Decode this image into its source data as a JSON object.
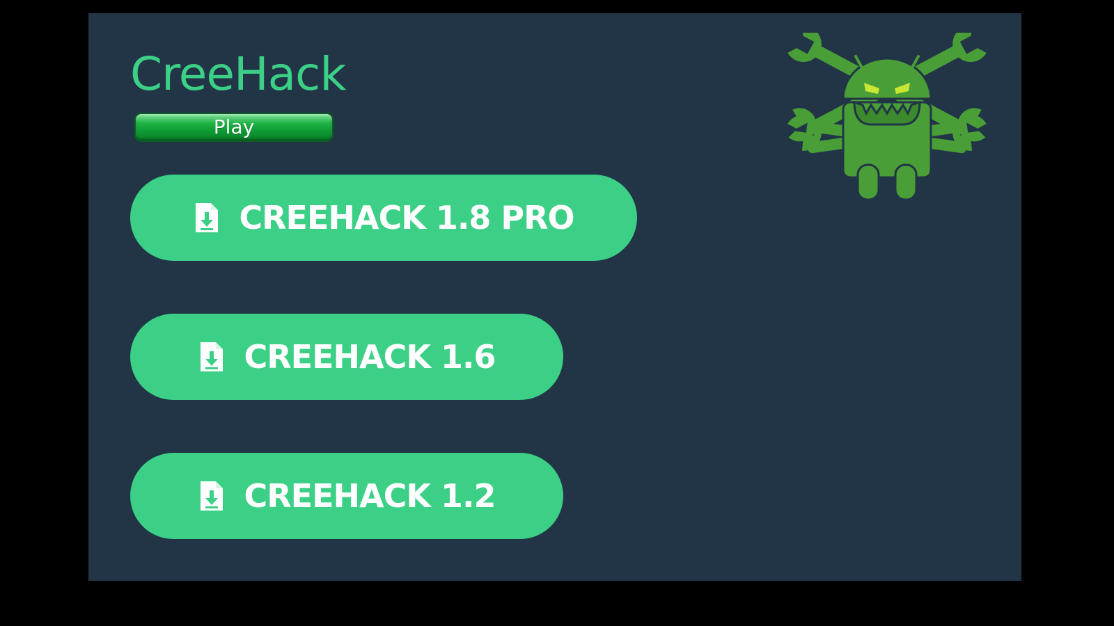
{
  "app": {
    "title": "CreeHack",
    "play_badge": "Play"
  },
  "buttons": [
    {
      "label": "CREEHACK 1.8 PRO",
      "icon": "file-download-icon"
    },
    {
      "label": "CREEHACK 1.6",
      "icon": "file-download-icon"
    },
    {
      "label": "CREEHACK 1.2",
      "icon": "file-download-icon"
    }
  ],
  "logo": {
    "icon": "android-skull-wrenches-icon"
  },
  "colors": {
    "background": "#000000",
    "panel": "#213547",
    "accent": "#3ccf86",
    "title": "#3cd087",
    "logo_green": "#4a9e37",
    "eye_yellow": "#c8e632",
    "play_green": "#1fb245"
  }
}
